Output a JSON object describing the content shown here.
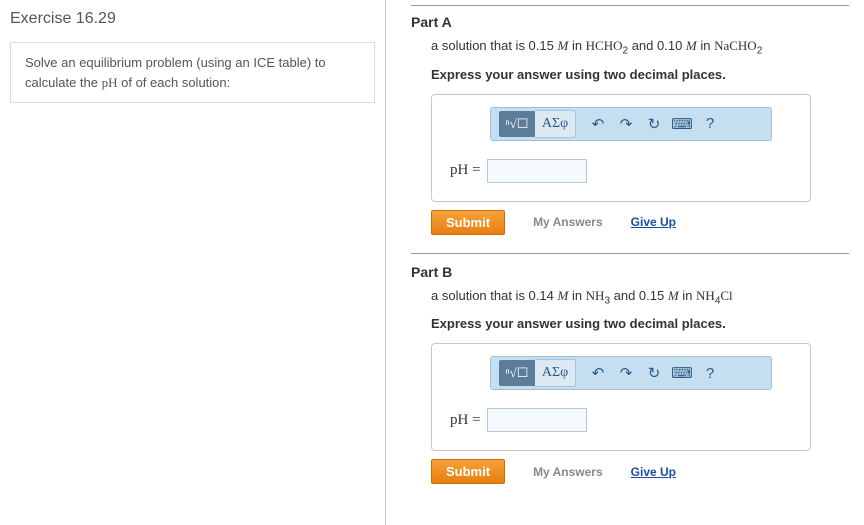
{
  "exercise": {
    "title": "Exercise 16.29"
  },
  "instruction": {
    "text_pre": "Solve an equilibrium problem (using an ICE table) to calculate the ",
    "ph": "pH",
    "text_post": " of of each solution:"
  },
  "toolbar": {
    "math": "x√☐",
    "greek": "ΑΣφ",
    "undo": "↶",
    "redo": "↷",
    "reset": "↻",
    "keyboard": "⌨",
    "help": "?"
  },
  "answer": {
    "label": "pH =",
    "value": ""
  },
  "actions": {
    "submit": "Submit",
    "my_answers": "My Answers",
    "give_up": "Give Up"
  },
  "partA": {
    "title": "Part A",
    "desc_pre": "a solution that is 0.15 ",
    "M": "M",
    "desc_mid1": " in ",
    "chem1_a": "HCHO",
    "chem1_sub": "2",
    "desc_mid2": "  and 0.10 ",
    "desc_mid3": " in ",
    "chem2_a": "NaCHO",
    "chem2_sub": "2",
    "instruction": "Express your answer using two decimal places."
  },
  "partB": {
    "title": "Part B",
    "desc_pre": "a solution that is 0.14 ",
    "M": "M",
    "desc_mid1": " in ",
    "chem1_a": "NH",
    "chem1_sub": "3",
    "desc_mid2": "  and 0.15 ",
    "desc_mid3": " in ",
    "chem2_a": "NH",
    "chem2_sub": "4",
    "chem2_b": "Cl",
    "instruction": "Express your answer using two decimal places."
  }
}
